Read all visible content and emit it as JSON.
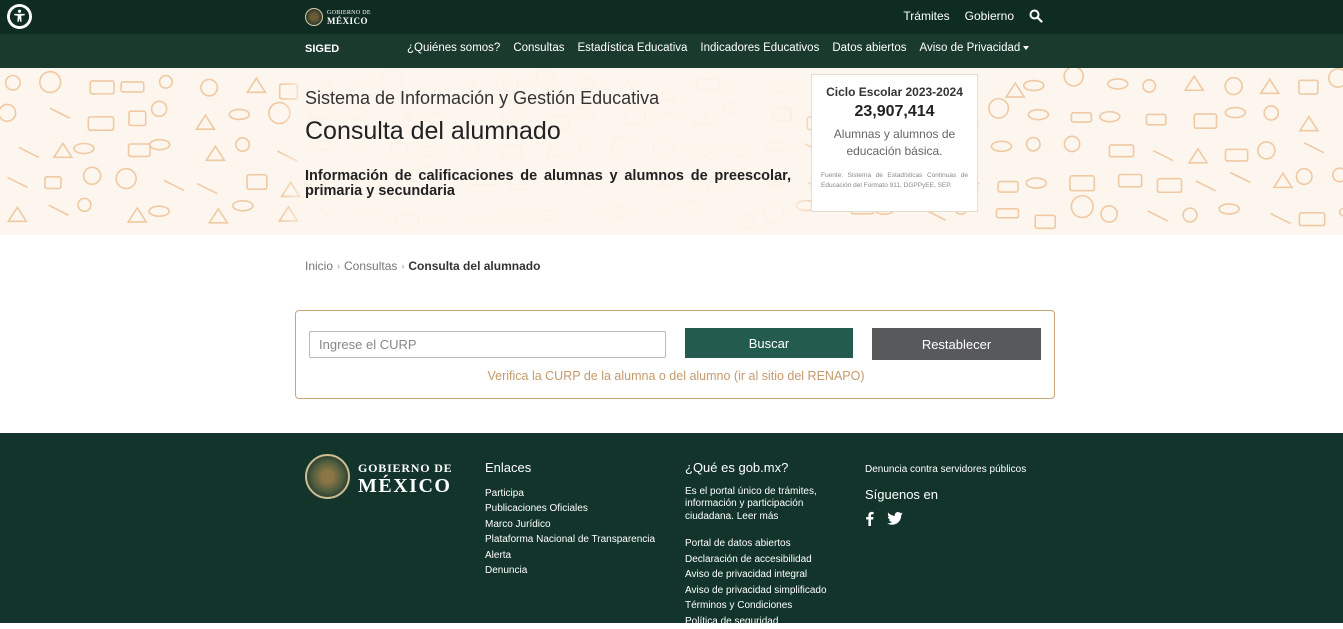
{
  "topbar": {
    "logo_line1": "GOBIERNO DE",
    "logo_line2": "MÉXICO",
    "links": [
      "Trámites",
      "Gobierno"
    ]
  },
  "navbar": {
    "brand": "SIGED",
    "items": [
      "¿Quiénes somos?",
      "Consultas",
      "Estadística Educativa",
      "Indicadores Educativos",
      "Datos abiertos",
      "Aviso de Privacidad"
    ]
  },
  "hero": {
    "subtitle": "Sistema de Información y Gestión Educativa",
    "title": "Consulta del alumnado",
    "description": "Información de calificaciones de alumnas y alumnos de preescolar, primaria y secundaria"
  },
  "stat": {
    "label": "Ciclo Escolar 2023-2024",
    "value": "23,907,414",
    "description": "Alumnas y alumnos de educación básica.",
    "source": "Fuente: Sistema de Estadísticas Continuas de Educación del Formato 911, DGPPyEE, SEP."
  },
  "breadcrumb": {
    "items": [
      "Inicio",
      "Consultas"
    ],
    "current": "Consulta del alumnado"
  },
  "search": {
    "placeholder": "Ingrese el CURP",
    "value": "",
    "search_label": "Buscar",
    "reset_label": "Restablecer",
    "verify_link": "Verifica la CURP de la alumna o del alumno (ir al sitio del RENAPO)"
  },
  "footer": {
    "logo_line1": "GOBIERNO DE",
    "logo_line2": "MÉXICO",
    "links_title": "Enlaces",
    "links": [
      "Participa",
      "Publicaciones Oficiales",
      "Marco Jurídico",
      "Plataforma Nacional de Transparencia",
      "Alerta",
      "Denuncia"
    ],
    "gobmx_title": "¿Qué es gob.mx?",
    "gobmx_intro": "Es el portal único de trámites, información y participación ciudadana. Leer más",
    "gobmx_links": [
      "Portal de datos abiertos",
      "Declaración de accesibilidad",
      "Aviso de privacidad integral",
      "Aviso de privacidad simplificado",
      "Términos y Condiciones",
      "Política de seguridad"
    ],
    "denuncia": "Denuncia contra servidores públicos",
    "follow": "Síguenos en"
  },
  "colors": {
    "topbar": "#0f2c22",
    "navbar": "#1a3a2e",
    "primary_button": "#235b4e",
    "secondary_button": "#58595b",
    "accent_gold": "#c49a6c",
    "footer": "#12342a"
  },
  "icons": [
    "accessibility-icon",
    "search-icon",
    "facebook-icon",
    "twitter-icon"
  ]
}
